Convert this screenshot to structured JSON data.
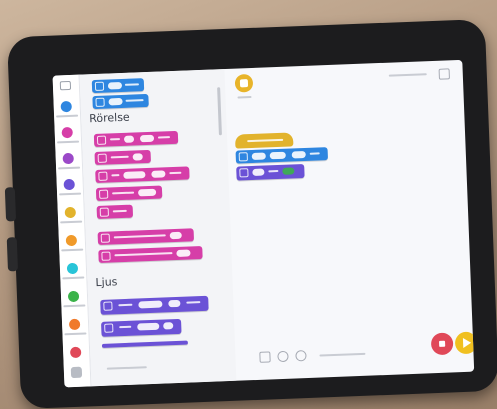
{
  "flyout": {
    "section_motor": "Rörelse",
    "section_light": "Ljus"
  },
  "colors": {
    "motor_blocks": "#d63ea8",
    "variable_blocks": "#2e86e0",
    "light_blocks": "#6b52d6",
    "event_blocks": "#e2b32c",
    "stop_button": "#e04858",
    "play_button": "#f0c020"
  },
  "icons": {
    "settings": "settings-icon",
    "sprite": "sprite-icon",
    "zoom_in": "zoom-in-icon",
    "zoom_out": "zoom-out-icon",
    "fit": "fit-icon"
  }
}
